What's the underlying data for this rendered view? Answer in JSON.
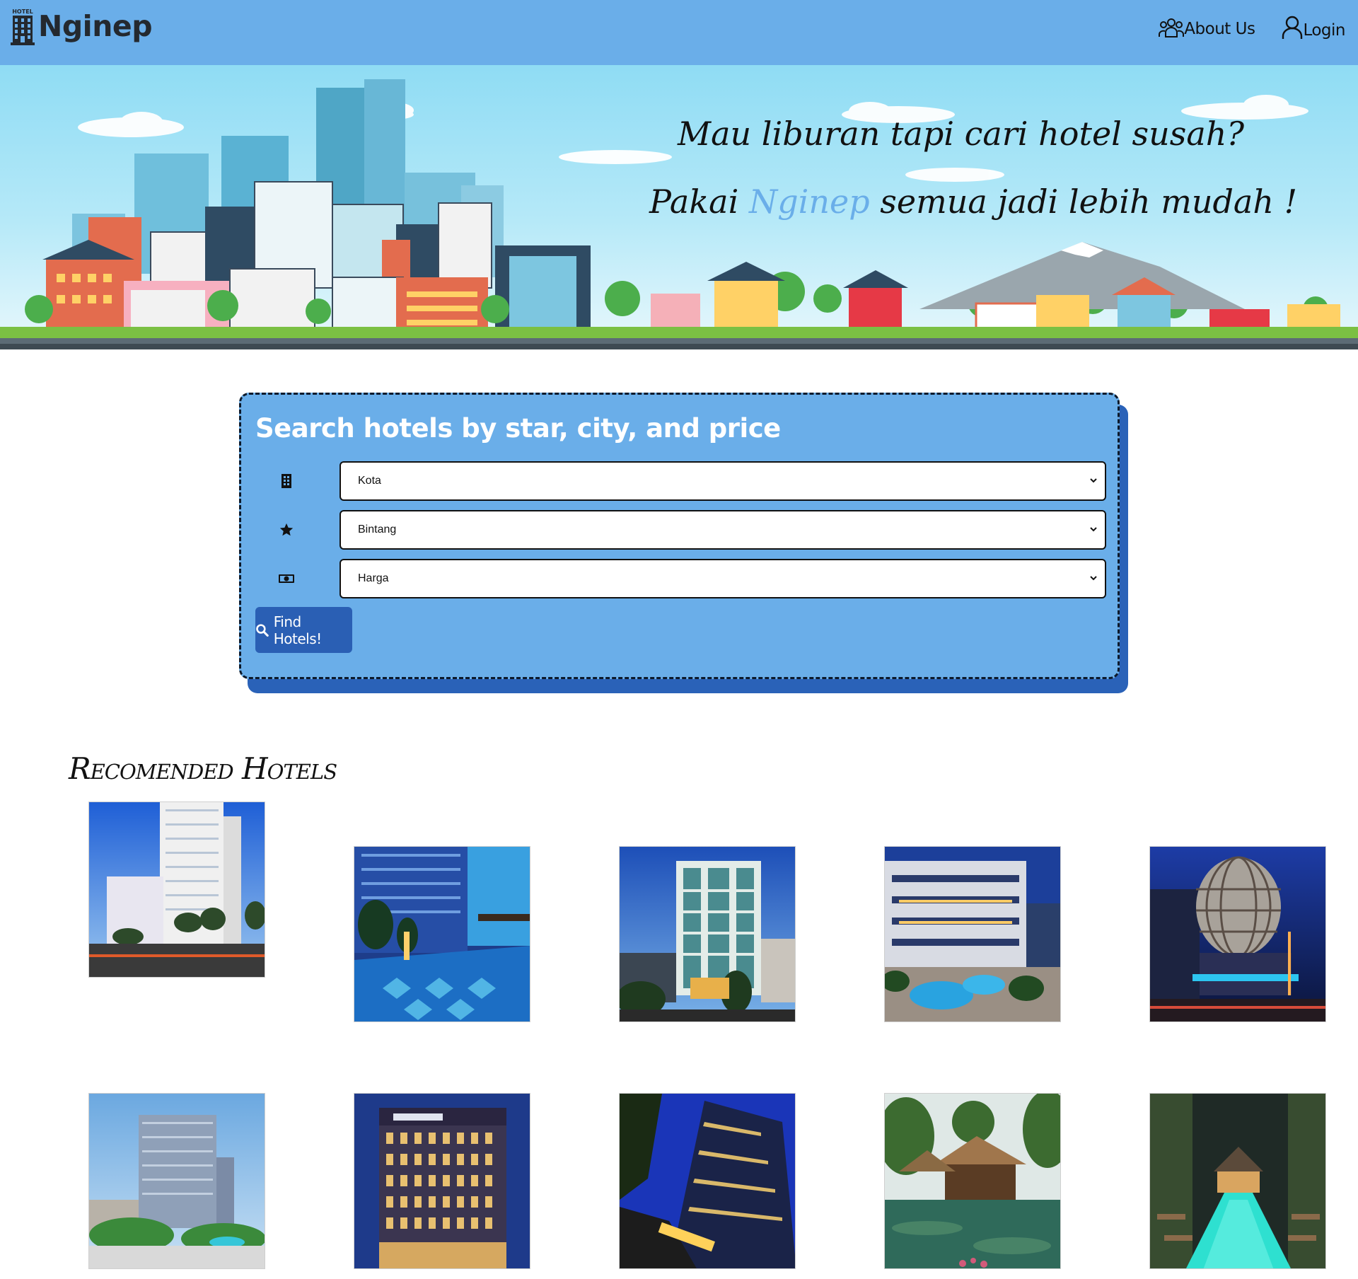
{
  "brand": {
    "name": "Nginep",
    "logo_text": "HOTEL"
  },
  "nav": {
    "about_label": "About Us",
    "login_label": "Login"
  },
  "hero": {
    "line1": "Mau liburan tapi cari hotel susah?",
    "line2_prefix": "Pakai",
    "line2_brand": "Nginep",
    "line2_suffix": "semua jadi lebih mudah !"
  },
  "search": {
    "title": "Search hotels by star, city, and price",
    "city_select": {
      "icon": "building-icon",
      "selected": "Kota"
    },
    "star_select": {
      "icon": "star-icon",
      "selected": "Bintang"
    },
    "price_select": {
      "icon": "money-icon",
      "selected": "Harga"
    },
    "button_label": "Find Hotels!"
  },
  "recommended": {
    "title": "Recomended Hotels",
    "hotels": [
      {
        "scene": "white-tower-blue-sky"
      },
      {
        "scene": "rooftop-pool-night"
      },
      {
        "scene": "modern-facade-dusk"
      },
      {
        "scene": "courtyard-pool-night"
      },
      {
        "scene": "dome-tower-night"
      },
      {
        "scene": "glass-tower-garden"
      },
      {
        "scene": "mercure-hotel-night"
      },
      {
        "scene": "skyscraper-lowangle-night"
      },
      {
        "scene": "resort-pond-thatched"
      },
      {
        "scene": "resort-lit-pool"
      }
    ]
  },
  "colors": {
    "navbar": "#6aaee9",
    "accent": "#6aaee9",
    "button": "#2a5fb4",
    "card_shadow": "#2a62b8"
  }
}
